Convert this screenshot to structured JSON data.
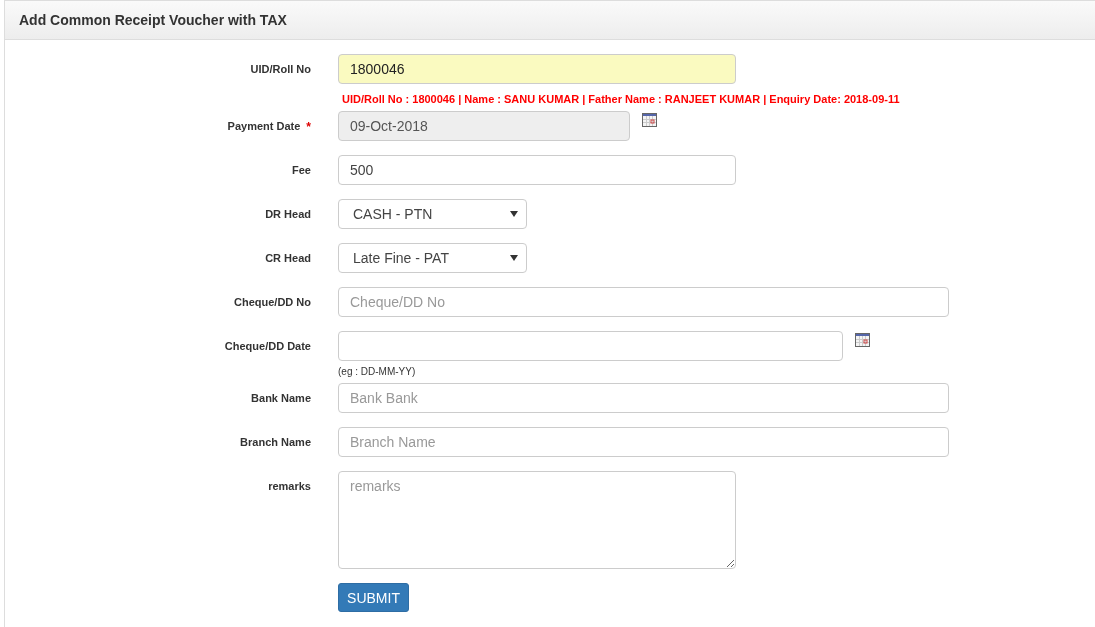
{
  "panel": {
    "title": "Add Common Receipt Voucher with TAX"
  },
  "fields": [
    {
      "kind": "text",
      "label": "UID/Roll No",
      "value": "1800046",
      "disabled": false,
      "highlighted": true,
      "info": "UID/Roll No : 1800046 |  Name : SANU KUMAR |  Father Name : RANJEET KUMAR |  Enquiry Date: 2018-09-11"
    },
    {
      "kind": "date",
      "label": "Payment Date",
      "value": "09-Oct-2018",
      "required_mark": "*",
      "disabled": true,
      "highlighted": false
    },
    {
      "kind": "text",
      "label": "Fee",
      "value": "500",
      "disabled": false,
      "highlighted": false
    },
    {
      "kind": "select",
      "label": "DR Head",
      "value": "CASH - PTN",
      "disabled": false,
      "highlighted": false
    },
    {
      "kind": "select",
      "label": "CR Head",
      "value": "Late Fine - PAT",
      "disabled": false,
      "highlighted": false
    },
    {
      "kind": "text",
      "label": "Cheque/DD No",
      "placeholder": "Cheque/DD No",
      "disabled": false,
      "highlighted": false
    },
    {
      "kind": "date",
      "label": "Cheque/DD Date",
      "hint": "(eg : DD-MM-YY)",
      "disabled": false,
      "highlighted": false
    },
    {
      "kind": "text",
      "label": "Bank Name",
      "placeholder": "Bank Bank",
      "disabled": false,
      "highlighted": false
    },
    {
      "kind": "text",
      "label": "Branch Name",
      "placeholder": "Branch Name",
      "disabled": false,
      "highlighted": false
    },
    {
      "kind": "textarea",
      "label": "remarks",
      "placeholder": "remarks",
      "disabled": false,
      "highlighted": false
    }
  ],
  "submit": "SUBMIT"
}
